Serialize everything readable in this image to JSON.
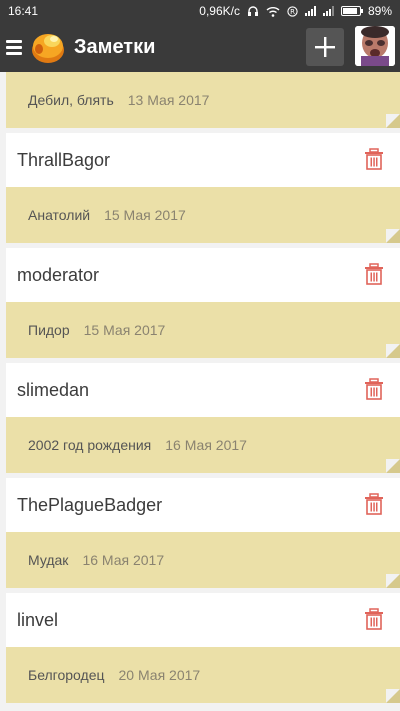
{
  "status": {
    "time": "16:41",
    "speed": "0,96K/c",
    "battery": "89%",
    "battery_level": 0.89
  },
  "appbar": {
    "title": "Заметки",
    "menu_icon": "hamburger-icon",
    "add_icon": "plus-icon"
  },
  "first_note": {
    "text": "Дебил, блять",
    "date": "13 Мая 2017"
  },
  "cards": [
    {
      "author": "ThrallBagor",
      "note": "Анатолий",
      "date": "15 Мая 2017"
    },
    {
      "author": "moderator",
      "note": "Пидор",
      "date": "15 Мая 2017"
    },
    {
      "author": "slimedan",
      "note": "2002 год рождения",
      "date": "16 Мая 2017"
    },
    {
      "author": "ThePlagueBadger",
      "note": "Мудак",
      "date": "16 Мая 2017"
    },
    {
      "author": "linvel",
      "note": "Белгородец",
      "date": "20 Мая 2017"
    }
  ],
  "colors": {
    "bar": "#3a3a3a",
    "note": "#ebe0a8",
    "trash": "#e0645a"
  }
}
